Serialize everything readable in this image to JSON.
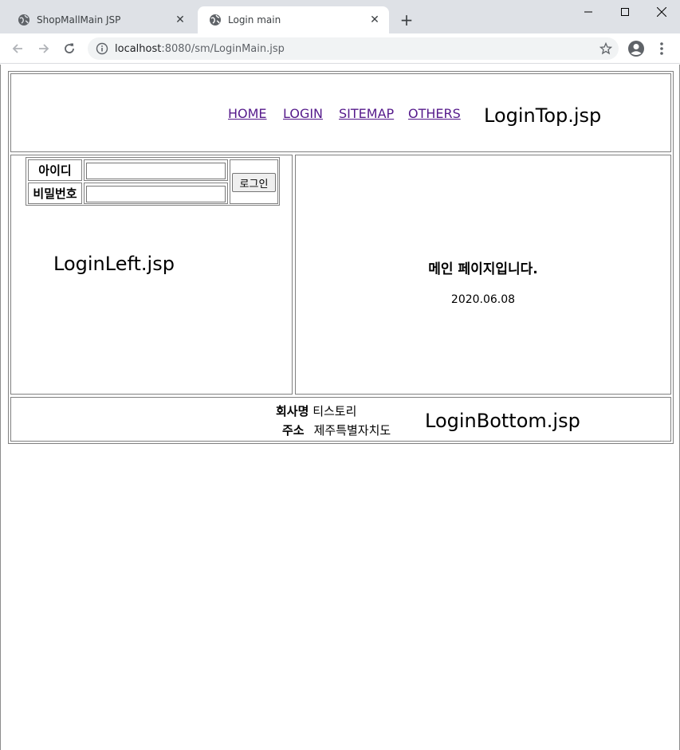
{
  "browser": {
    "tabs": [
      {
        "title": "ShopMallMain JSP",
        "active": false
      },
      {
        "title": "Login main",
        "active": true
      }
    ],
    "url_host": "localhost",
    "url_rest": ":8080/sm/LoginMain.jsp"
  },
  "top": {
    "menu": [
      "HOME",
      "LOGIN",
      "SITEMAP",
      "OTHERS"
    ],
    "label": "LoginTop.jsp"
  },
  "left": {
    "id_label": "아이디",
    "pw_label": "비밀번호",
    "id_value": "",
    "pw_value": "",
    "login_button": "로그인",
    "label": "LoginLeft.jsp"
  },
  "main": {
    "title": "메인 페이지입니다.",
    "date": "2020.06.08"
  },
  "bottom": {
    "company_label": "회사명",
    "company_value": "티스토리",
    "address_label": "주소",
    "address_value": "제주특별자치도",
    "label": "LoginBottom.jsp"
  },
  "colors": {
    "link_visited": "#551a8b",
    "tabbar": "#dee1e6"
  }
}
